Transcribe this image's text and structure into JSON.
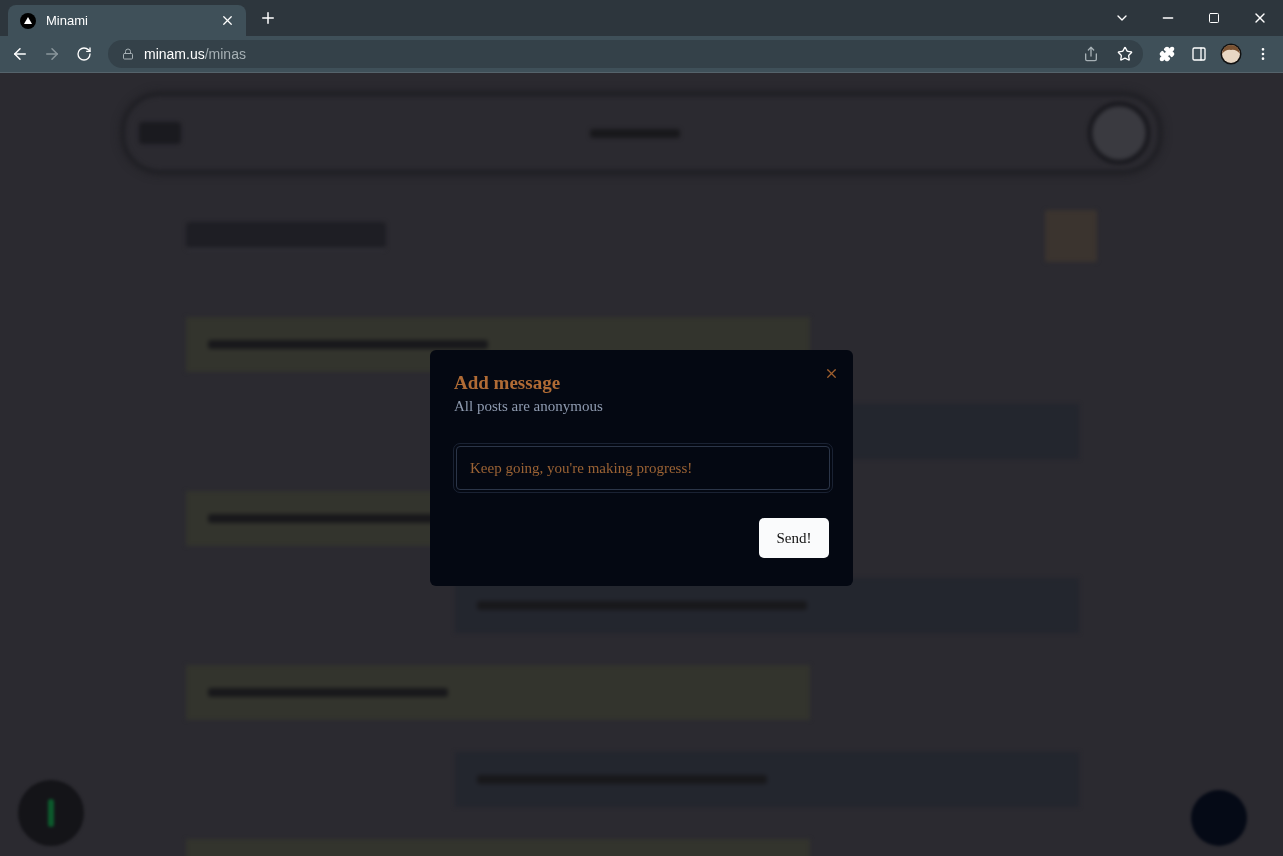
{
  "browser": {
    "tab": {
      "title": "Minami",
      "selected": true
    },
    "url": {
      "host": "minam.us",
      "path": "/minas"
    }
  },
  "page": {
    "background_cards": [
      {
        "kind": "left"
      },
      {
        "kind": "right"
      },
      {
        "kind": "left"
      },
      {
        "kind": "right"
      },
      {
        "kind": "left"
      },
      {
        "kind": "right"
      },
      {
        "kind": "left"
      }
    ]
  },
  "dialog": {
    "title": "Add message",
    "subtitle": "All posts are anonymous",
    "input": {
      "value": "Keep going, you're making progress!"
    },
    "button": "Send!"
  }
}
